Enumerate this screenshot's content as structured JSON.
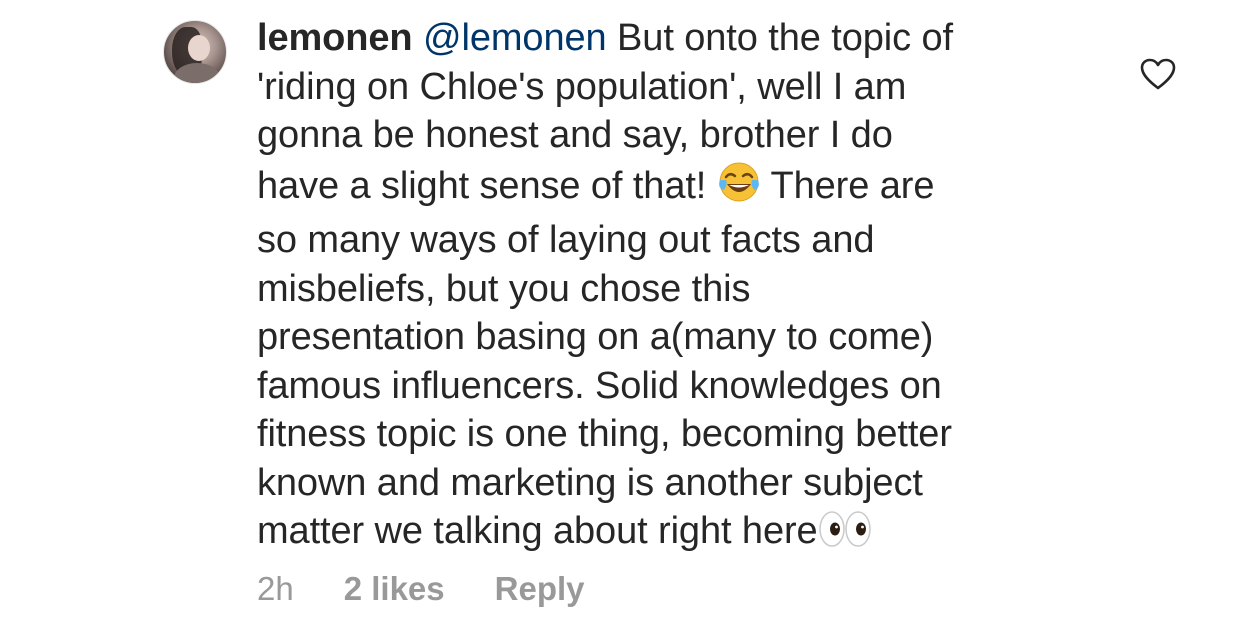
{
  "comment": {
    "username": "lemonen",
    "mention": "@lemonen",
    "lines": [
      " But onto the topic of",
      "'riding on Chloe's population', well I am",
      "gonna be honest and say, brother I do",
      "have a slight sense of that! ",
      " There are",
      "so many ways of laying out facts and",
      "misbeliefs, but you chose this",
      "presentation basing on a(many to come)",
      "famous influencers. Solid knowledges on",
      "fitness topic is one thing, becoming better",
      "known and marketing is another subject",
      "matter we talking about right here"
    ],
    "emoji_laugh": "face-with-tears-of-joy-icon",
    "emoji_eyes": "eyes-icon"
  },
  "meta": {
    "time": "2h",
    "likes": "2 likes",
    "reply": "Reply"
  },
  "icons": {
    "like": "heart-icon",
    "avatar": "avatar"
  },
  "colors": {
    "text": "#262626",
    "mention": "#003569",
    "meta": "#999999",
    "heart_stroke": "#262626"
  }
}
